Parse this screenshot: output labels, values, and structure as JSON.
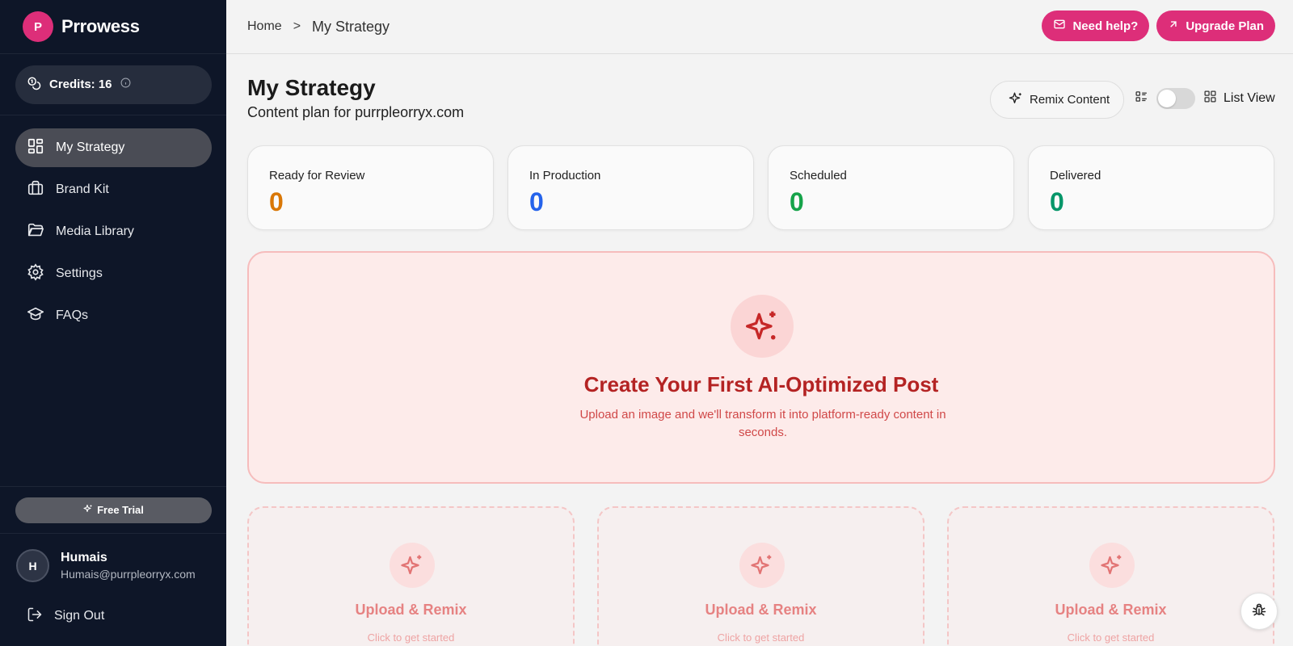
{
  "brand": {
    "logo_letter": "P",
    "name": "Prrowess"
  },
  "credits": {
    "label": "Credits: 16"
  },
  "sidebar": {
    "items": [
      {
        "label": "My Strategy",
        "icon": "dashboard-icon",
        "active": true
      },
      {
        "label": "Brand Kit",
        "icon": "briefcase-icon"
      },
      {
        "label": "Media Library",
        "icon": "folder-icon"
      },
      {
        "label": "Settings",
        "icon": "gear-icon"
      },
      {
        "label": "FAQs",
        "icon": "graduation-cap-icon"
      }
    ],
    "trial_label": "Free Trial",
    "user": {
      "initial": "H",
      "name": "Humais",
      "email": "Humais@purrpleorryx.com"
    },
    "signout_label": "Sign Out"
  },
  "topbar": {
    "breadcrumb": {
      "home": "Home",
      "separator": ">",
      "current": "My Strategy"
    },
    "help_label": "Need help?",
    "upgrade_label": "Upgrade Plan"
  },
  "main": {
    "title": "My Strategy",
    "subtitle": "Content plan for purrpleorryx.com",
    "remix_label": "Remix Content",
    "view_label": "List View",
    "stats": [
      {
        "label": "Ready for Review",
        "value": "0",
        "color": "#d97706"
      },
      {
        "label": "In Production",
        "value": "0",
        "color": "#2563eb"
      },
      {
        "label": "Scheduled",
        "value": "0",
        "color": "#16a34a"
      },
      {
        "label": "Delivered",
        "value": "0",
        "color": "#059669"
      }
    ],
    "hero": {
      "title": "Create Your First AI-Optimized Post",
      "description": "Upload an image and we'll transform it into platform-ready content in seconds."
    },
    "cards": [
      {
        "title": "Upload & Remix",
        "subtitle": "Click to get started"
      },
      {
        "title": "Upload & Remix",
        "subtitle": "Click to get started"
      },
      {
        "title": "Upload & Remix",
        "subtitle": "Click to get started"
      }
    ]
  },
  "colors": {
    "accent": "#dd2e79",
    "sidebar_bg": "#0e1628",
    "hero_title": "#b42323"
  }
}
